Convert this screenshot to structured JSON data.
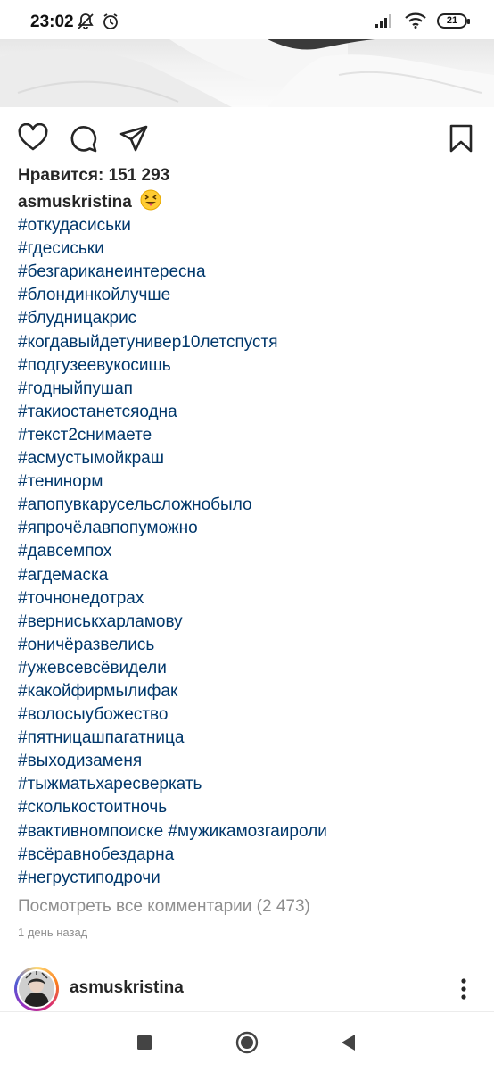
{
  "status_bar": {
    "time": "23:02",
    "battery": "21",
    "icons": [
      "mute-bell-icon",
      "alarm-icon",
      "signal-icon",
      "wifi-icon",
      "battery-icon"
    ]
  },
  "post": {
    "likes_label": "Нравится: 151 293",
    "username": "asmuskristina",
    "emoji": "squinting-tongue-emoji",
    "hashtags": [
      "#откудасиськи",
      "#гдесиськи",
      "#безгариканеинтересна",
      "#блондинкойлучше",
      "#блудницакрис",
      "#когдавыйдетунивер10летспустя",
      "#подгузеевукосишь",
      "#годныйпушап",
      "#такиостанетсяодна",
      "#текст2снимаете",
      "#асмустымойкраш",
      "#тенинорм",
      "#апопувкарусельсложнобыло",
      "#япрочёлавпопуможно",
      "#давсемпох",
      "#агдемаска",
      "#точнонедотрах",
      "#верниськхарламову",
      "#оничёразвелись",
      "#ужевсевсёвидели",
      "#какойфирмылифак",
      "#волосыубожество",
      "#пятницашпагатница",
      "#выходизаменя",
      "#тыжматьхаресверкать",
      "#сколькостоитночь",
      "#вактивномпоиске #мужикамозгаироли",
      "#всёравнобездарна",
      "#негрустиподрочи"
    ],
    "view_comments": "Посмотреть все комментарии (2 473)",
    "time_ago": "1 день назад"
  },
  "next_post": {
    "username": "asmuskristina"
  },
  "colors": {
    "hashtag": "#00376b",
    "muted": "#8e8e8e",
    "text": "#262626"
  }
}
